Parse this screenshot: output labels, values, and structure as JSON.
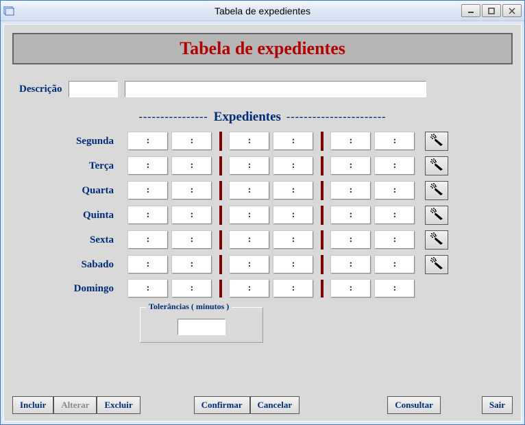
{
  "window_title": "Tabela de expedientes",
  "banner_title": "Tabela de expedientes",
  "labels": {
    "descricao": "Descrição",
    "section": "Expedientes",
    "tolerancias": "Tolerâncias ( minutos )"
  },
  "descricao": {
    "code": "",
    "text": ""
  },
  "days": [
    {
      "label": "Segunda",
      "p1a": ":",
      "p1b": ":",
      "p2a": ":",
      "p2b": ":",
      "p3a": ":",
      "p3b": ":"
    },
    {
      "label": "Terça",
      "p1a": ":",
      "p1b": ":",
      "p2a": ":",
      "p2b": ":",
      "p3a": ":",
      "p3b": ":"
    },
    {
      "label": "Quarta",
      "p1a": ":",
      "p1b": ":",
      "p2a": ":",
      "p2b": ":",
      "p3a": ":",
      "p3b": ":"
    },
    {
      "label": "Quinta",
      "p1a": ":",
      "p1b": ":",
      "p2a": ":",
      "p2b": ":",
      "p3a": ":",
      "p3b": ":"
    },
    {
      "label": "Sexta",
      "p1a": ":",
      "p1b": ":",
      "p2a": ":",
      "p2b": ":",
      "p3a": ":",
      "p3b": ":"
    },
    {
      "label": "Sabado",
      "p1a": ":",
      "p1b": ":",
      "p2a": ":",
      "p2b": ":",
      "p3a": ":",
      "p3b": ":"
    },
    {
      "label": "Domingo",
      "p1a": ":",
      "p1b": ":",
      "p2a": ":",
      "p2b": ":",
      "p3a": ":",
      "p3b": ":"
    }
  ],
  "tolerancias": "",
  "buttons": {
    "incluir": "Incluir",
    "alterar": "Alterar",
    "excluir": "Excluir",
    "confirmar": "Confirmar",
    "cancelar": "Cancelar",
    "consultar": "Consultar",
    "sair": "Sair"
  },
  "dashes_left": "----------------",
  "dashes_right": "-----------------------"
}
